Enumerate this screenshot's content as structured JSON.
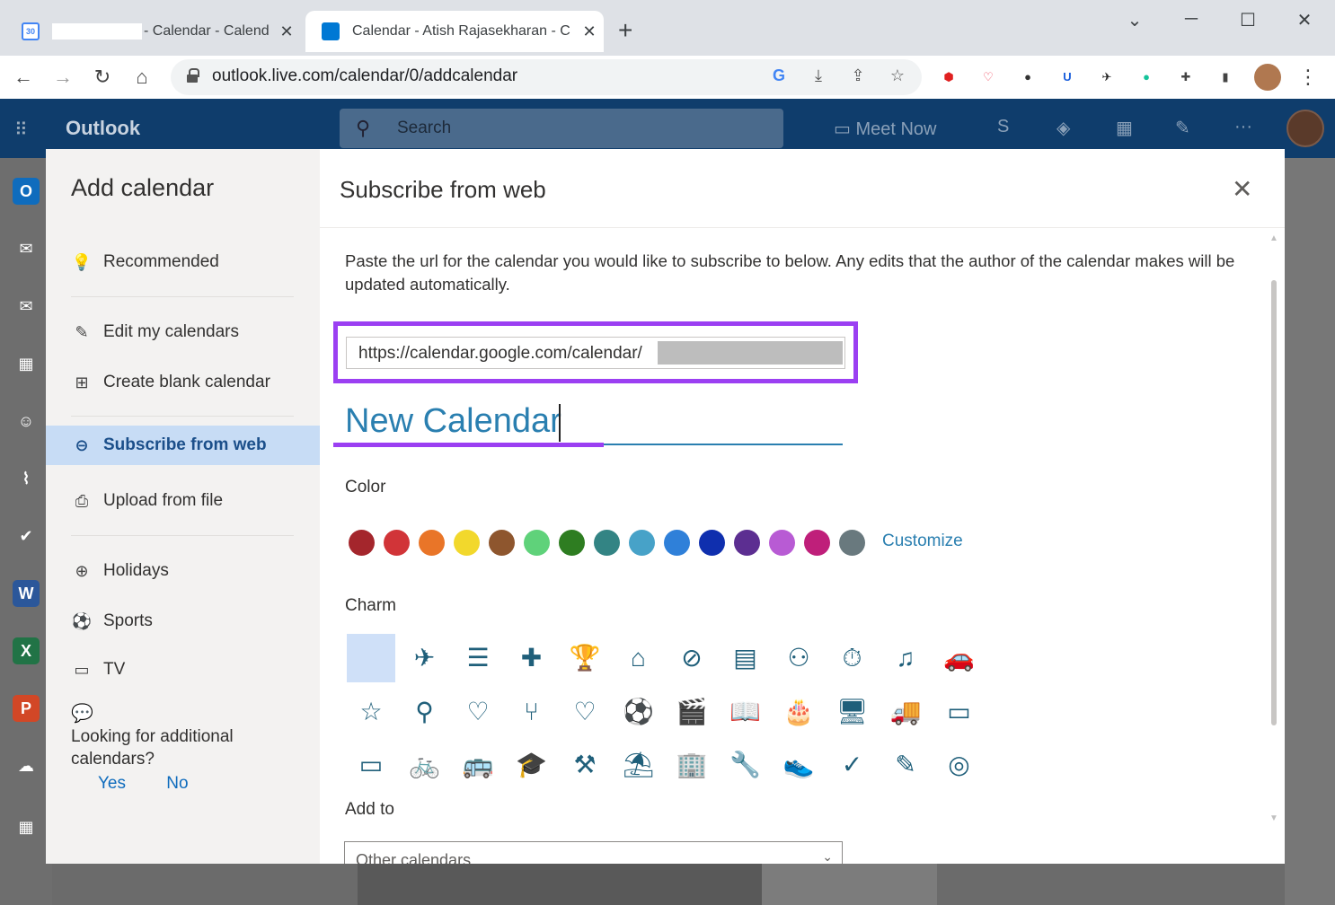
{
  "browser": {
    "tabs": [
      {
        "favicon_text": "30",
        "title": "- Calendar - Calend",
        "close": "✕"
      },
      {
        "title": "Calendar - Atish Rajasekharan - C",
        "close": "✕"
      }
    ],
    "new_tab": "+",
    "window_controls": {
      "menu": "⌄",
      "minimize": "─",
      "maximize": "☐",
      "close": "✕"
    },
    "nav": {
      "back": "←",
      "forward": "→",
      "reload": "↻",
      "home": "⌂"
    },
    "url": "outlook.live.com/calendar/0/addcalendar",
    "omnibox_icons": [
      "G",
      "⤓",
      "⇪",
      "☆"
    ],
    "extensions": [
      {
        "name": "ublock-icon",
        "glyph": "⬢",
        "color": "#e02020"
      },
      {
        "name": "pocket-icon",
        "glyph": "♡",
        "color": "#ef4056"
      },
      {
        "name": "spy-icon",
        "glyph": "●",
        "color": "#333333"
      },
      {
        "name": "bitwarden-icon",
        "glyph": "U",
        "color": "#175ddc"
      },
      {
        "name": "send-icon",
        "glyph": "✈",
        "color": "#222222"
      },
      {
        "name": "grammarly-icon",
        "glyph": "●",
        "color": "#15c39a"
      },
      {
        "name": "puzzle-icon",
        "glyph": "✚",
        "color": "#444444"
      },
      {
        "name": "sidepanel-icon",
        "glyph": "▮",
        "color": "#444444"
      }
    ],
    "more": "⋮"
  },
  "outlook": {
    "brand": "Outlook",
    "search_placeholder": "Search",
    "meet_now": "Meet Now",
    "header_icons": [
      "S",
      "◈",
      "▦",
      "✎",
      "···"
    ],
    "rail_icons": [
      {
        "name": "outlook-logo-icon",
        "glyph": "O",
        "color": "#0f6cbd"
      },
      {
        "name": "new-mail-icon",
        "glyph": "✉",
        "color": "#6e6e6e"
      },
      {
        "name": "mail-icon",
        "glyph": "✉",
        "color": "#6e6e6e"
      },
      {
        "name": "calendar-icon",
        "glyph": "▦",
        "color": "#6e6e6e"
      },
      {
        "name": "people-icon",
        "glyph": "☺",
        "color": "#6e6e6e"
      },
      {
        "name": "attach-icon",
        "glyph": "⌇",
        "color": "#6e6e6e"
      },
      {
        "name": "todo-icon",
        "glyph": "✔",
        "color": "#6e6e6e"
      },
      {
        "name": "word-icon",
        "glyph": "W",
        "color": "#2b579a"
      },
      {
        "name": "excel-icon",
        "glyph": "X",
        "color": "#217346"
      },
      {
        "name": "powerpoint-icon",
        "glyph": "P",
        "color": "#d24726"
      },
      {
        "name": "onedrive-icon",
        "glyph": "☁",
        "color": "#6e6e6e"
      },
      {
        "name": "apps-icon",
        "glyph": "▦",
        "color": "#6e6e6e"
      }
    ]
  },
  "dialog": {
    "left_title": "Add calendar",
    "menu": [
      {
        "icon": "💡",
        "icon_name": "lightbulb-icon",
        "label": "Recommended"
      },
      {
        "icon": "✎",
        "icon_name": "edit-calendar-icon",
        "label": "Edit my calendars"
      },
      {
        "icon": "⊞",
        "icon_name": "new-calendar-icon",
        "label": "Create blank calendar"
      },
      {
        "icon": "⊖",
        "icon_name": "web-subscribe-icon",
        "label": "Subscribe from web"
      },
      {
        "icon": "⎙",
        "icon_name": "upload-file-icon",
        "label": "Upload from file"
      },
      {
        "icon": "⊕",
        "icon_name": "globe-icon",
        "label": "Holidays"
      },
      {
        "icon": "⚽",
        "icon_name": "sports-icon",
        "label": "Sports"
      },
      {
        "icon": "▭",
        "icon_name": "tv-icon",
        "label": "TV"
      }
    ],
    "looking_for": "Looking for additional calendars?",
    "yes": "Yes",
    "no": "No",
    "right_title": "Subscribe from web",
    "close": "✕",
    "description": "Paste the url for the calendar you would like to subscribe to below. Any edits that the author of the calendar makes will be updated automatically.",
    "url_value": "https://calendar.google.com/calendar/",
    "calendar_name": "New Calendar",
    "color_label": "Color",
    "colors": [
      "#a4262c",
      "#d13438",
      "#e97528",
      "#f2d82c",
      "#8e562e",
      "#5fd27a",
      "#2e7d21",
      "#338484",
      "#47a2c8",
      "#2f80d9",
      "#0f2fae",
      "#5c2e91",
      "#b85bd4",
      "#bf1f7a",
      "#69797e"
    ],
    "customize": "Customize",
    "charm_label": "Charm",
    "charms": [
      [
        "",
        "✈",
        "☰",
        "✚",
        "🏆",
        "⌂",
        "⊘",
        "▤",
        "⚇",
        "⏱",
        "♫",
        "🚗"
      ],
      [
        "☆",
        "⚲",
        "♡",
        "⑂",
        "♡",
        "⚽",
        "🎬",
        "📖",
        "🎂",
        "🖥",
        "🚚",
        "▭"
      ],
      [
        "▭",
        "🚲",
        "🚌",
        "🎓",
        "⚒",
        "⛱",
        "🏢",
        "🔧",
        "👟",
        "✓",
        "✎",
        "◎"
      ]
    ],
    "add_to_label": "Add to",
    "add_to_value": "Other calendars",
    "add_to_chevron": "⌄"
  }
}
